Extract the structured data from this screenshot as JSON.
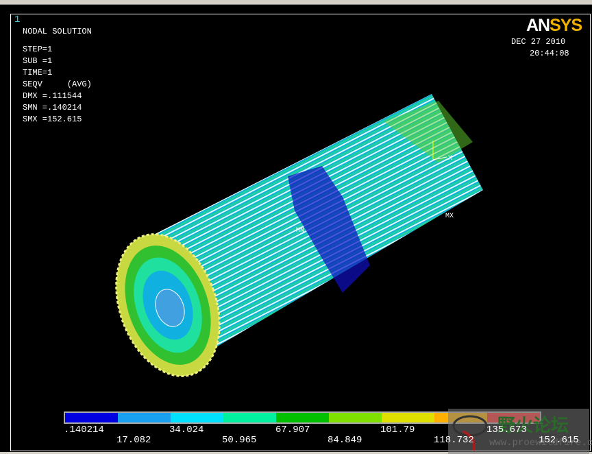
{
  "window_number": "1",
  "info": {
    "title": "NODAL SOLUTION",
    "lines": [
      "STEP=1",
      "SUB =1",
      "TIME=1",
      "SEQV     (AVG)",
      "DMX =.111544",
      "SMN =.140214",
      "SMX =152.615"
    ]
  },
  "logo": {
    "part1": "AN",
    "part2": "SYS"
  },
  "date": "DEC 27 2010",
  "time": "20:44:08",
  "markers": {
    "min": "MN",
    "max": "MX",
    "axis": "X"
  },
  "legend": {
    "colors": [
      "#0000e0",
      "#1aa0f0",
      "#00e0ff",
      "#00f0a0",
      "#00c000",
      "#80e000",
      "#e0e000",
      "#ffb000",
      "#ff3030"
    ],
    "labels_top": [
      ".140214",
      "34.024",
      "67.907",
      "101.79",
      "135.673"
    ],
    "labels_bottom": [
      "17.082",
      "50.965",
      "84.849",
      "118.732",
      "152.615"
    ]
  },
  "watermark": {
    "text": "野火论坛",
    "url": "www.proewildfire.cn"
  }
}
